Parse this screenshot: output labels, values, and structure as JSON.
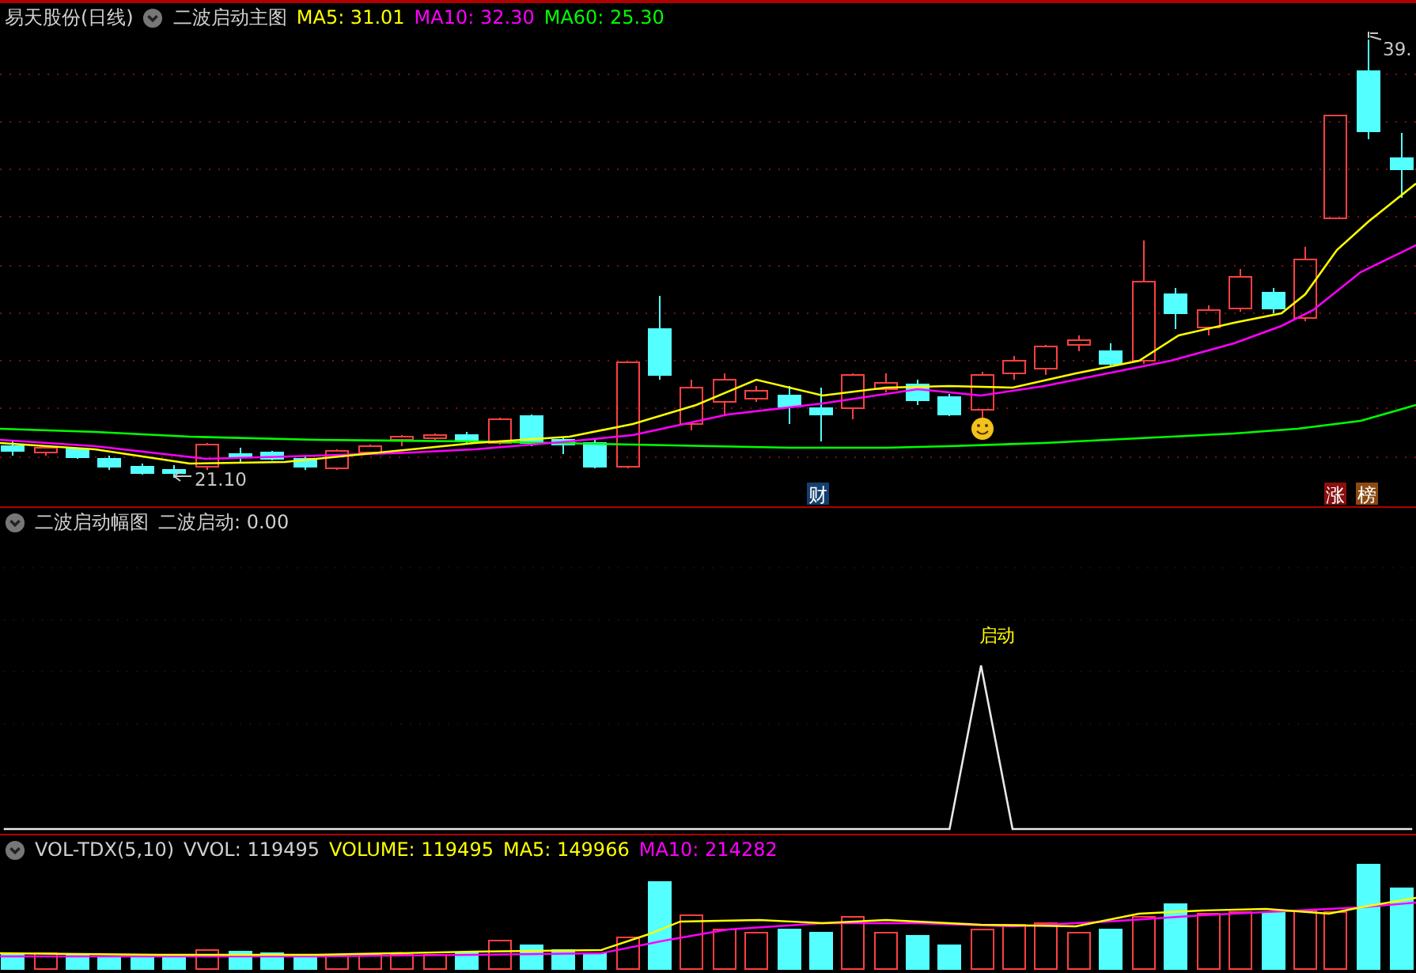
{
  "main_panel": {
    "stock_title": "易天股份(日线)",
    "indicator_name": "二波启动主图",
    "ma_readings": [
      {
        "text": "MA5: 31.01",
        "color": "#ffff00"
      },
      {
        "text": "MA10: 32.30",
        "color": "#ff00ff"
      },
      {
        "text": "MA60: 25.30",
        "color": "#00ff00"
      }
    ],
    "high_label": "39.",
    "low_label": "21.10",
    "badges": [
      {
        "text": "财",
        "color": "#123f6e"
      },
      {
        "text": "涨",
        "color": "#8a0f0f"
      },
      {
        "text": "榜",
        "color": "#8a4a12"
      }
    ]
  },
  "signal_panel": {
    "indicator_name": "二波启动幅图",
    "reading": "二波启动: 0.00",
    "signal_label": "启动"
  },
  "volume_panel": {
    "indicator_name": "VOL-TDX(5,10)",
    "readings": [
      {
        "text": "VVOL: 119495",
        "color": "#d0d0d0"
      },
      {
        "text": "VOLUME: 119495",
        "color": "#ffff00"
      },
      {
        "text": "MA5: 149966",
        "color": "#ffff00"
      },
      {
        "text": "MA10: 214282",
        "color": "#ff00ff"
      }
    ]
  }
}
